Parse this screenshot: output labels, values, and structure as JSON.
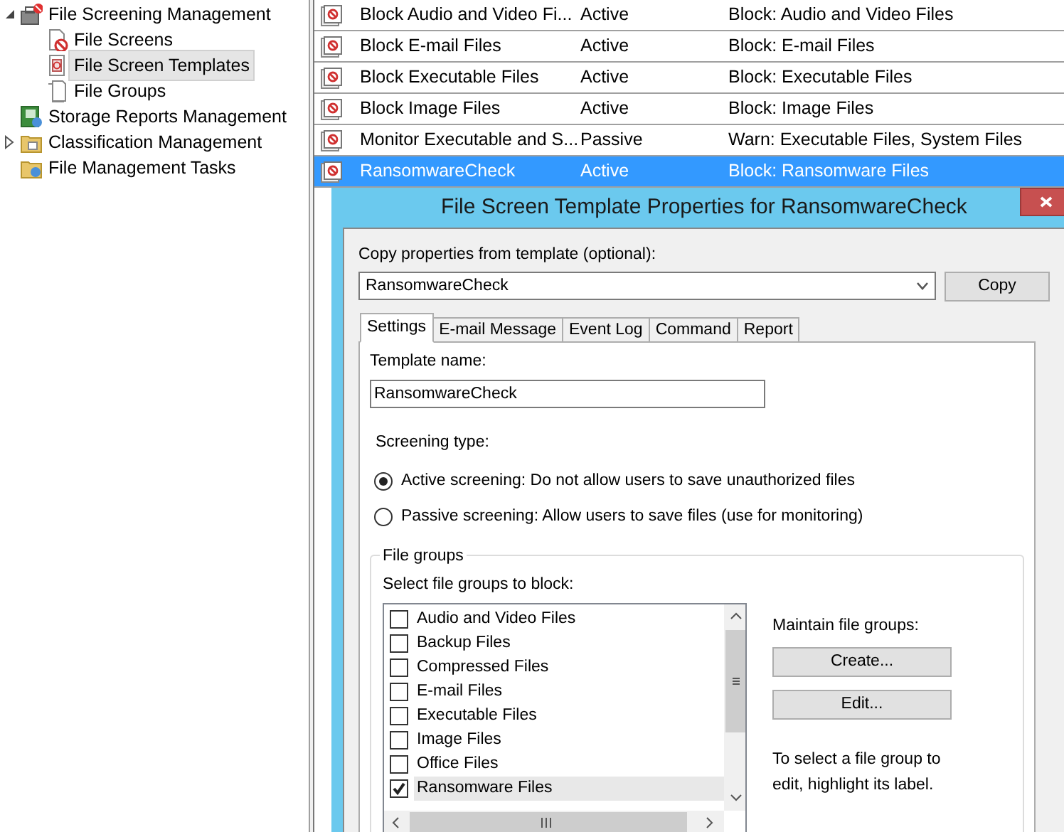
{
  "tree": [
    {
      "label": "File Screening Management",
      "kind": "screening",
      "expanded": true,
      "selected": false,
      "children": [
        {
          "label": "File Screens",
          "kind": "screens",
          "selected": false
        },
        {
          "label": "File Screen Templates",
          "kind": "templates",
          "selected": true
        },
        {
          "label": "File Groups",
          "kind": "groups",
          "selected": false
        }
      ]
    },
    {
      "label": "Storage Reports Management",
      "kind": "reports",
      "selected": false
    },
    {
      "label": "Classification Management",
      "kind": "folder",
      "expanded": false,
      "selected": false
    },
    {
      "label": "File Management Tasks",
      "kind": "tasks",
      "selected": false
    }
  ],
  "table": {
    "rows": [
      {
        "name": "Block Audio and Video Fi...",
        "mode": "Active",
        "description": "Block: Audio and Video Files",
        "selected": false
      },
      {
        "name": "Block E-mail Files",
        "mode": "Active",
        "description": "Block: E-mail Files",
        "selected": false
      },
      {
        "name": "Block Executable Files",
        "mode": "Active",
        "description": "Block: Executable Files",
        "selected": false
      },
      {
        "name": "Block Image Files",
        "mode": "Active",
        "description": "Block: Image Files",
        "selected": false
      },
      {
        "name": "Monitor Executable and S...",
        "mode": "Passive",
        "description": "Warn: Executable Files, System Files",
        "selected": false
      },
      {
        "name": "RansomwareCheck",
        "mode": "Active",
        "description": "Block: Ransomware Files",
        "selected": true
      }
    ]
  },
  "dialog": {
    "title": "File Screen Template Properties for RansomwareCheck",
    "copy_label": "Copy properties from template (optional):",
    "copy_value": "RansomwareCheck",
    "copy_button": "Copy",
    "tabs": [
      {
        "label": "Settings",
        "selected": true
      },
      {
        "label": "E-mail Message",
        "selected": false
      },
      {
        "label": "Event Log",
        "selected": false
      },
      {
        "label": "Command",
        "selected": false
      },
      {
        "label": "Report",
        "selected": false
      }
    ],
    "template_name_label": "Template name:",
    "template_name": "RansomwareCheck",
    "screening_type_label": "Screening type:",
    "screening_options": [
      {
        "label": "Active screening: Do not allow users to save unauthorized files",
        "selected": true
      },
      {
        "label": "Passive screening: Allow users to save files (use for monitoring)",
        "selected": false
      }
    ],
    "file_groups_legend": "File groups",
    "select_label": "Select file groups to block:",
    "file_groups": [
      {
        "label": "Audio and Video Files",
        "checked": false,
        "selected": false
      },
      {
        "label": "Backup Files",
        "checked": false,
        "selected": false
      },
      {
        "label": "Compressed Files",
        "checked": false,
        "selected": false
      },
      {
        "label": "E-mail Files",
        "checked": false,
        "selected": false
      },
      {
        "label": "Executable Files",
        "checked": false,
        "selected": false
      },
      {
        "label": "Image Files",
        "checked": false,
        "selected": false
      },
      {
        "label": "Office Files",
        "checked": false,
        "selected": false
      },
      {
        "label": "Ransomware Files",
        "checked": true,
        "selected": true
      }
    ],
    "maintain_label": "Maintain file groups:",
    "buttons": [
      "Create...",
      "Edit..."
    ],
    "hint": "To select a file group to edit, highlight its label."
  }
}
